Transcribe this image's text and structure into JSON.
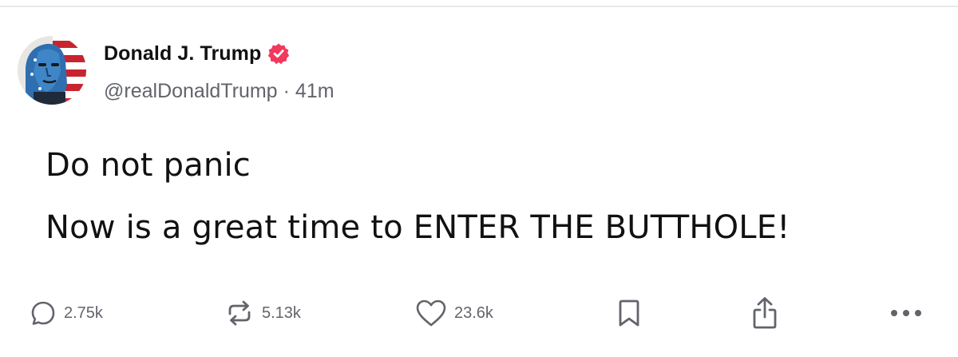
{
  "post": {
    "author": {
      "display_name": "Donald J. Trump",
      "handle": "@realDonaldTrump",
      "separator": "·",
      "time_ago": "41m",
      "verified": true,
      "verified_color": "#f2385b"
    },
    "text_lines": [
      "Do not panic",
      "Now is a great time to ENTER THE BUTTHOLE!"
    ],
    "actions": {
      "reply": {
        "icon": "reply-icon",
        "count": "2.75k"
      },
      "repost": {
        "icon": "repost-icon",
        "count": "5.13k"
      },
      "like": {
        "icon": "heart-icon",
        "count": "23.6k"
      },
      "bookmark": {
        "icon": "bookmark-icon"
      },
      "share": {
        "icon": "share-icon"
      },
      "more": {
        "icon": "more-icon"
      }
    }
  },
  "colors": {
    "text_primary": "#111111",
    "text_secondary": "#62646b",
    "icon": "#62646b",
    "divider": "#e9e9ec"
  }
}
